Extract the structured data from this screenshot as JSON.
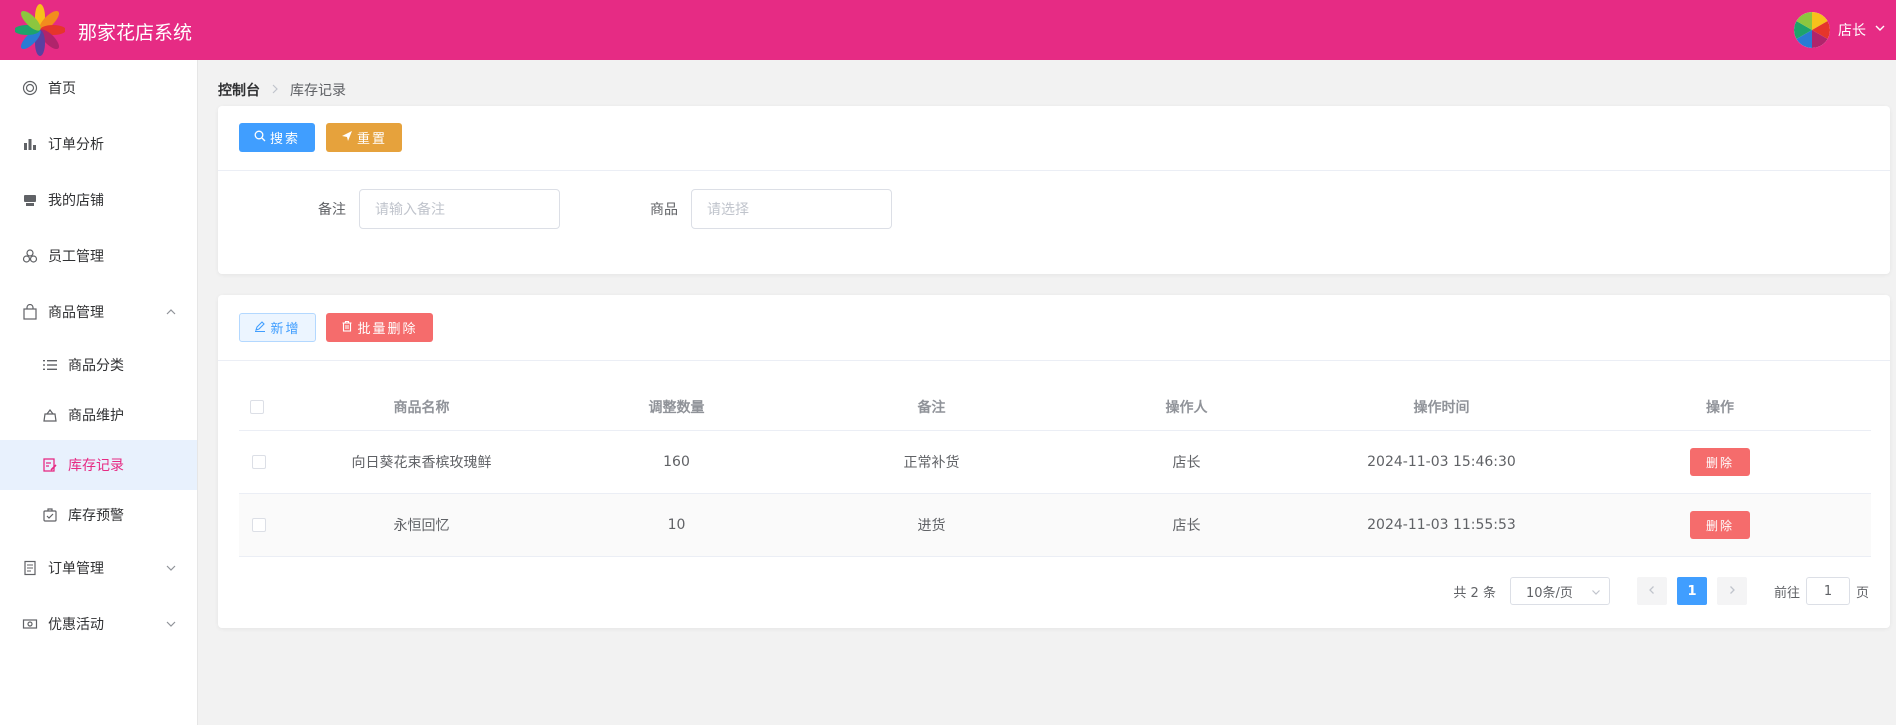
{
  "header": {
    "app_title": "那家花店系统",
    "user_name": "店长",
    "brand_color": "#e62b84"
  },
  "sidebar": {
    "items": [
      {
        "label": "首页",
        "icon": "home-icon"
      },
      {
        "label": "订单分析",
        "icon": "bar-chart-icon"
      },
      {
        "label": "我的店铺",
        "icon": "shop-icon"
      },
      {
        "label": "员工管理",
        "icon": "users-icon"
      },
      {
        "label": "商品管理",
        "icon": "bag-icon",
        "expanded": true
      },
      {
        "label": "订单管理",
        "icon": "document-icon",
        "expanded": false
      },
      {
        "label": "优惠活动",
        "icon": "ticket-icon",
        "expanded": false
      }
    ],
    "subitems": [
      {
        "label": "商品分类",
        "icon": "list-icon"
      },
      {
        "label": "商品维护",
        "icon": "goods-icon"
      },
      {
        "label": "库存记录",
        "icon": "edit-record-icon",
        "active": true
      },
      {
        "label": "库存预警",
        "icon": "alert-box-icon"
      }
    ]
  },
  "breadcrumb": {
    "root": "控制台",
    "current": "库存记录"
  },
  "search": {
    "search_btn": "搜索",
    "reset_btn": "重置",
    "remark_label": "备注",
    "remark_placeholder": "请输入备注",
    "goods_label": "商品",
    "goods_placeholder": "请选择"
  },
  "toolbar": {
    "add_btn": "新增",
    "batch_delete_btn": "批量删除"
  },
  "table": {
    "columns": [
      "商品名称",
      "调整数量",
      "备注",
      "操作人",
      "操作时间",
      "操作"
    ],
    "rows": [
      {
        "name": "向日葵花束香槟玫瑰鲜",
        "qty": "160",
        "remark": "正常补货",
        "operator": "店长",
        "time": "2024-11-03 15:46:30",
        "action": "删除"
      },
      {
        "name": "永恒回忆",
        "qty": "10",
        "remark": "进货",
        "operator": "店长",
        "time": "2024-11-03 11:55:53",
        "action": "删除"
      }
    ]
  },
  "pagination": {
    "total": "共 2 条",
    "page_size": "10条/页",
    "current_page": "1",
    "goto_label": "前往",
    "goto_value": "1",
    "page_suffix": "页"
  }
}
